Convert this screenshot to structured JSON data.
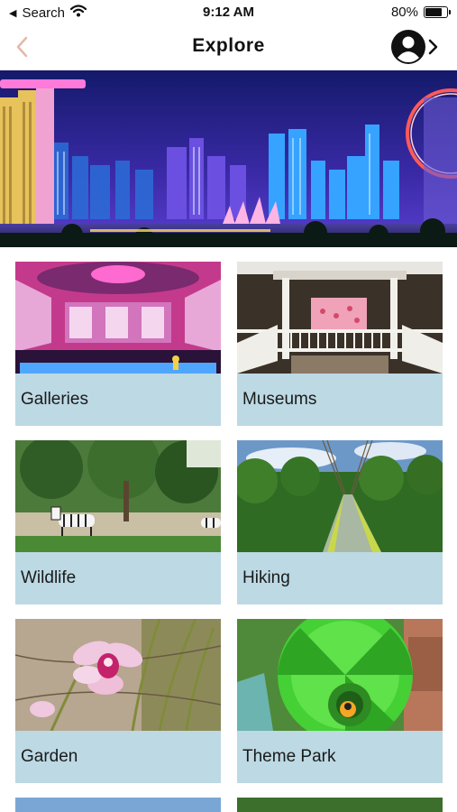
{
  "status_bar": {
    "back_label": "Search",
    "time": "9:12 AM",
    "battery": "80%",
    "battery_level": 0.8
  },
  "nav": {
    "title": "Explore",
    "back_icon": "chevron-left-icon",
    "profile_icon": "user-circle-icon"
  },
  "colors": {
    "label_bg": "#bcd9e4",
    "back_chevron": "#e5b9a8"
  },
  "categories": [
    {
      "label": "Galleries"
    },
    {
      "label": "Museums"
    },
    {
      "label": "Wildlife"
    },
    {
      "label": "Hiking"
    },
    {
      "label": "Garden"
    },
    {
      "label": "Theme Park"
    }
  ]
}
